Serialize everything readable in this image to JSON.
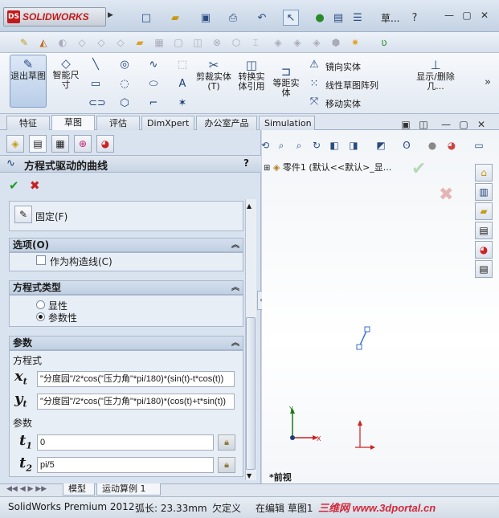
{
  "app": {
    "logo_text": "SOLIDWORKS",
    "title_short": "草...",
    "help_symbol": "?"
  },
  "ribbon": {
    "exit_sketch": "退出草图",
    "smart_dim": "智能尺寸",
    "trim": "剪裁实体(T)",
    "convert": "转换实体引用",
    "offset": "等距实体",
    "mirror": "镜向实体",
    "linear_pattern": "线性草图阵列",
    "move": "移动实体",
    "show_delete": "显示/删除几..."
  },
  "tabs": [
    "特征",
    "草图",
    "评估",
    "DimXpert",
    "办公室产品",
    "Simulation"
  ],
  "panel": {
    "title": "方程式驱动的曲线",
    "help": "?",
    "fixed_label": "固定(F)",
    "options_header": "选项(O)",
    "construction_label": "作为构造线(C)",
    "type_header": "方程式类型",
    "explicit_label": "显性",
    "parametric_label": "参数性",
    "params_header": "参数",
    "equation_label": "方程式",
    "xt_value": "\"分度园\"/2*cos(\"压力角\"*pi/180)*(sin(t)-t*cos(t))",
    "yt_value": "\"分度园\"/2*cos(\"压力角\"*pi/180)*(cos(t)+t*sin(t))",
    "param_label": "参数",
    "t1_value": "0",
    "t2_value": "pi/5"
  },
  "vars": {
    "x": "x",
    "y": "y",
    "t": "t",
    "sub_t": "t",
    "sub_1": "1",
    "sub_2": "2"
  },
  "graphics": {
    "tree_item": "零件1 (默认<<默认>_显...",
    "view_label": "*前视",
    "axis_x": "X",
    "axis_y": "Y"
  },
  "bottom_tabs": [
    "模型",
    "运动算例 1"
  ],
  "status": {
    "app_version": "SolidWorks Premium 2012",
    "arc_length": "弧长: 23.33mm",
    "constraint": "欠定义",
    "editing": "在编辑 草图1",
    "watermark": "三维网 www.3dportal.cn"
  }
}
